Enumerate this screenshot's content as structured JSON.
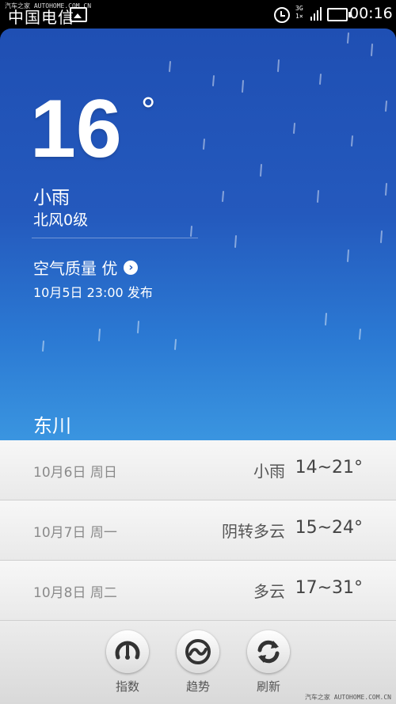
{
  "status_bar": {
    "carrier": "中国电信",
    "watermark": "汽车之家 AUTOHOME.COM.CN",
    "network": "3G",
    "network2": "1×",
    "time": "00:16"
  },
  "current": {
    "temperature": "16",
    "degree_symbol": "°",
    "condition": "小雨",
    "wind": "北风0级",
    "air_quality_label": "空气质量 优",
    "published": "10月5日 23:00 发布",
    "city": "东川",
    "page_indicator": {
      "total": 2,
      "active": 2
    }
  },
  "forecast": [
    {
      "date": "10月6日 周日",
      "condition": "小雨",
      "temp": "14~21°"
    },
    {
      "date": "10月7日 周一",
      "condition": "阴转多云",
      "temp": "15~24°"
    },
    {
      "date": "10月8日 周二",
      "condition": "多云",
      "temp": "17~31°"
    }
  ],
  "toolbar": {
    "index_label": "指数",
    "trend_label": "趋势",
    "refresh_label": "刷新"
  },
  "footer_watermark": "汽车之家 AUTOHOME.COM.CN",
  "colors": {
    "sky_top": "#1f4fb3",
    "sky_bottom": "#3a95e0",
    "icon": "#333333"
  }
}
